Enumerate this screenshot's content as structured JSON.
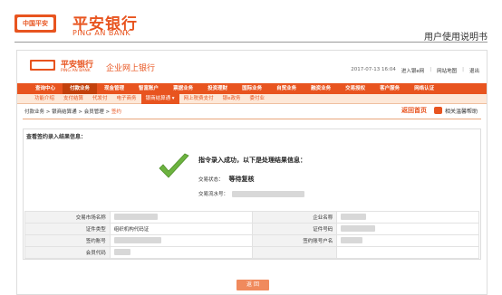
{
  "manual": {
    "logo_badge": "中国平安",
    "logo_cn": "平安银行",
    "logo_en": "PING AN BANK",
    "doc_title": "用户使用说明书"
  },
  "bank": {
    "logo_cn": "平安银行",
    "logo_en": "PING AN BANK",
    "site_title": "企业网上银行",
    "datetime": "2017-07-13 16:04",
    "links": [
      "进入银e网",
      "网站地图",
      "退出"
    ]
  },
  "nav": {
    "items": [
      "查询中心",
      "付款业务",
      "现金管理",
      "智富账户",
      "票据业务",
      "投资理财",
      "国际业务",
      "自贸业务",
      "融资业务",
      "交易授权",
      "客户服务",
      "网络认证"
    ],
    "active_index": 1
  },
  "subnav": {
    "items": [
      "功能介绍",
      "支付结算",
      "代发付",
      "电子商务",
      "银商结算通 ▾",
      "网上税费支付",
      "银e政务",
      "委付业"
    ],
    "active_index": 4
  },
  "breadcrumb": {
    "parts": [
      "付款业务",
      "银商结算通",
      "会员管理"
    ],
    "current": "签约"
  },
  "tools": {
    "home": "返回首页",
    "help": "相关温馨帮助"
  },
  "result": {
    "section_title": "查看签约录入结果信息：",
    "success_message": "指令录入成功，以下是处理结果信息：",
    "status_label": "交易状态：",
    "status_value": "等待复核",
    "serial_label": "交易流水号："
  },
  "info_table": {
    "rows": [
      {
        "label1": "交易市场名称",
        "value1": "",
        "label2": "企业名称",
        "value2": ""
      },
      {
        "label1": "证件类型",
        "value1": "组织机构代码证",
        "label2": "证件号码",
        "value2": ""
      },
      {
        "label1": "签约账号",
        "value1": "",
        "label2": "签约账号户名",
        "value2": ""
      },
      {
        "label1": "会员代码",
        "value1": "",
        "label2": "",
        "value2": ""
      }
    ]
  },
  "back_button": "返 回",
  "colors": {
    "brand": "#e8541f",
    "brand_dark": "#c2410c",
    "subnav_bg": "#fde8d8",
    "check_green": "#6cb33f"
  }
}
